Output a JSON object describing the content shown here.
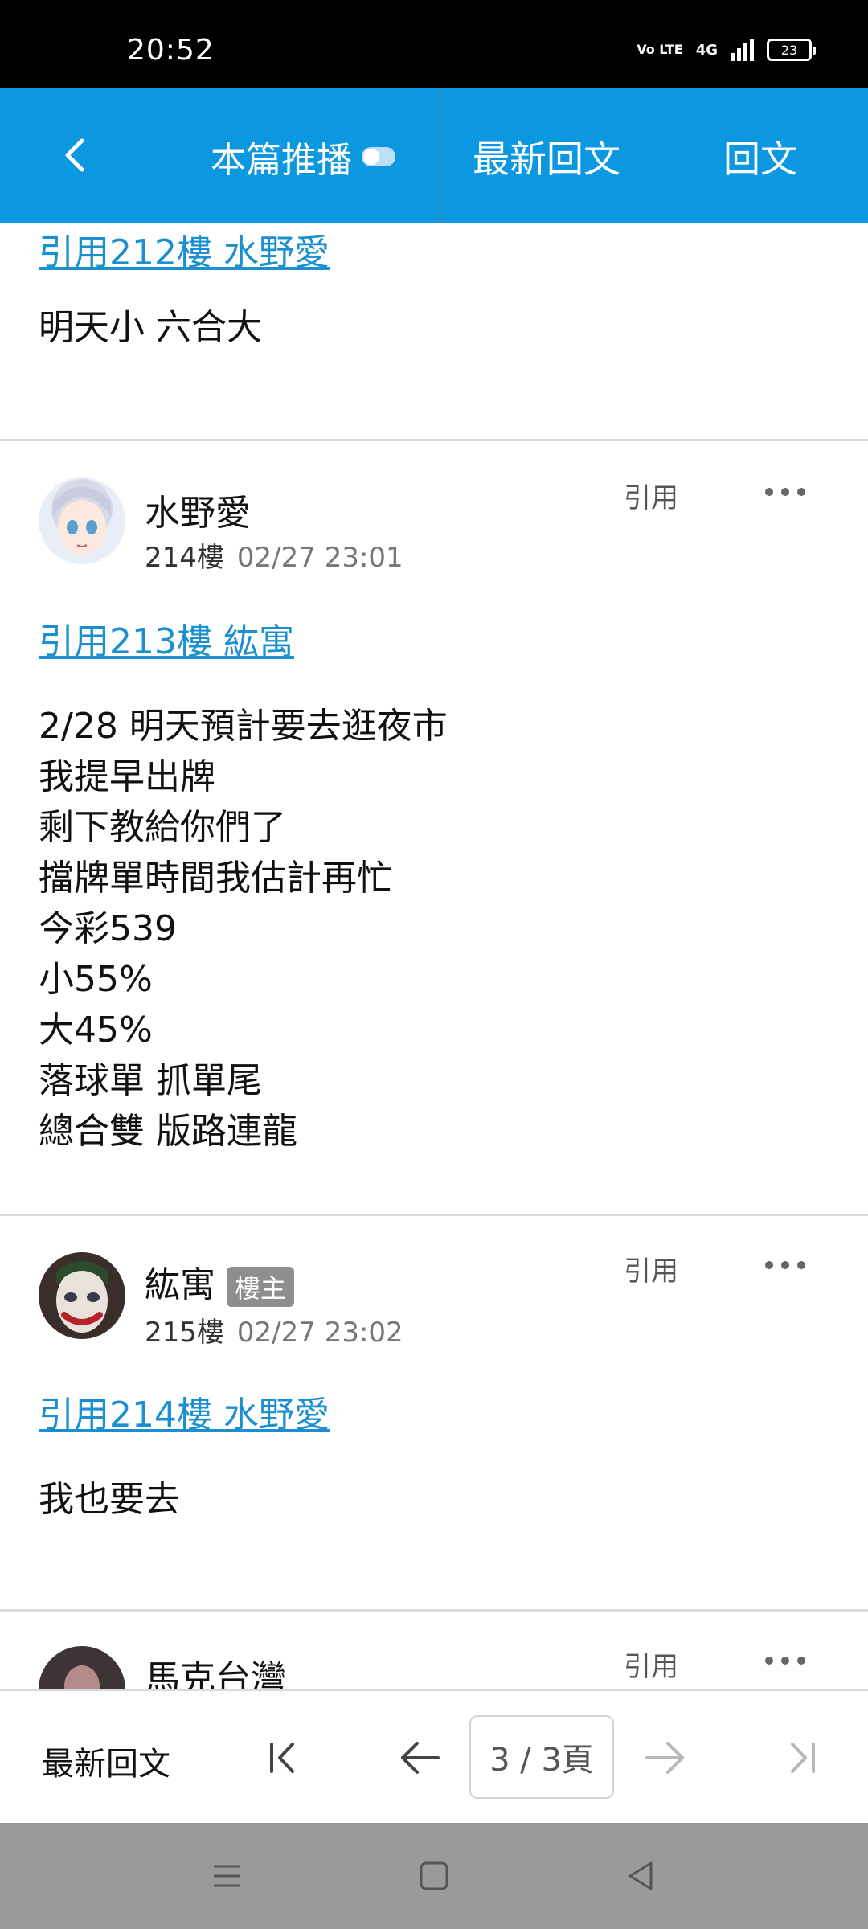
{
  "status_bar": {
    "time": "20:52",
    "volte": "Vo LTE",
    "network": "4G",
    "battery": "23"
  },
  "app_bar": {
    "push_label": "本篇推播",
    "latest_reply_label": "最新回文",
    "reply_label": "回文"
  },
  "posts": {
    "partial_top": {
      "quote_link": "引用212樓 水野愛",
      "lines": [
        "明天小 六合大"
      ]
    },
    "post_214": {
      "username": "水野愛",
      "floor": "214樓",
      "time": "02/27 23:01",
      "quote_label": "引用",
      "quote_link": "引用213樓 紘寓",
      "lines": [
        "2/28 明天預計要去逛夜市",
        "我提早出牌",
        "剩下教給你們了",
        "擋牌單時間我估計再忙",
        "今彩539",
        "小55%",
        "大45%",
        "落球單 抓單尾",
        "總合雙 版路連龍"
      ]
    },
    "post_215": {
      "username": "紘寓",
      "badge": "樓主",
      "floor": "215樓",
      "time": "02/27 23:02",
      "quote_label": "引用",
      "quote_link": "引用214樓 水野愛",
      "lines": [
        "我也要去"
      ]
    },
    "post_216_partial": {
      "username": "馬克台灣",
      "quote_label": "引用"
    }
  },
  "pager": {
    "latest_reply_label": "最新回文",
    "page_indicator": "3 / 3頁"
  },
  "colors": {
    "accent": "#0b98e0",
    "link": "#1b8fd0",
    "nav_bar": "#9a9a9a"
  },
  "icons": [
    "back-arrow-icon",
    "toggle-icon",
    "more-dots-icon",
    "first-page-icon",
    "prev-page-icon",
    "next-page-icon",
    "last-page-icon",
    "menu-icon",
    "home-icon",
    "back-triangle-icon"
  ]
}
